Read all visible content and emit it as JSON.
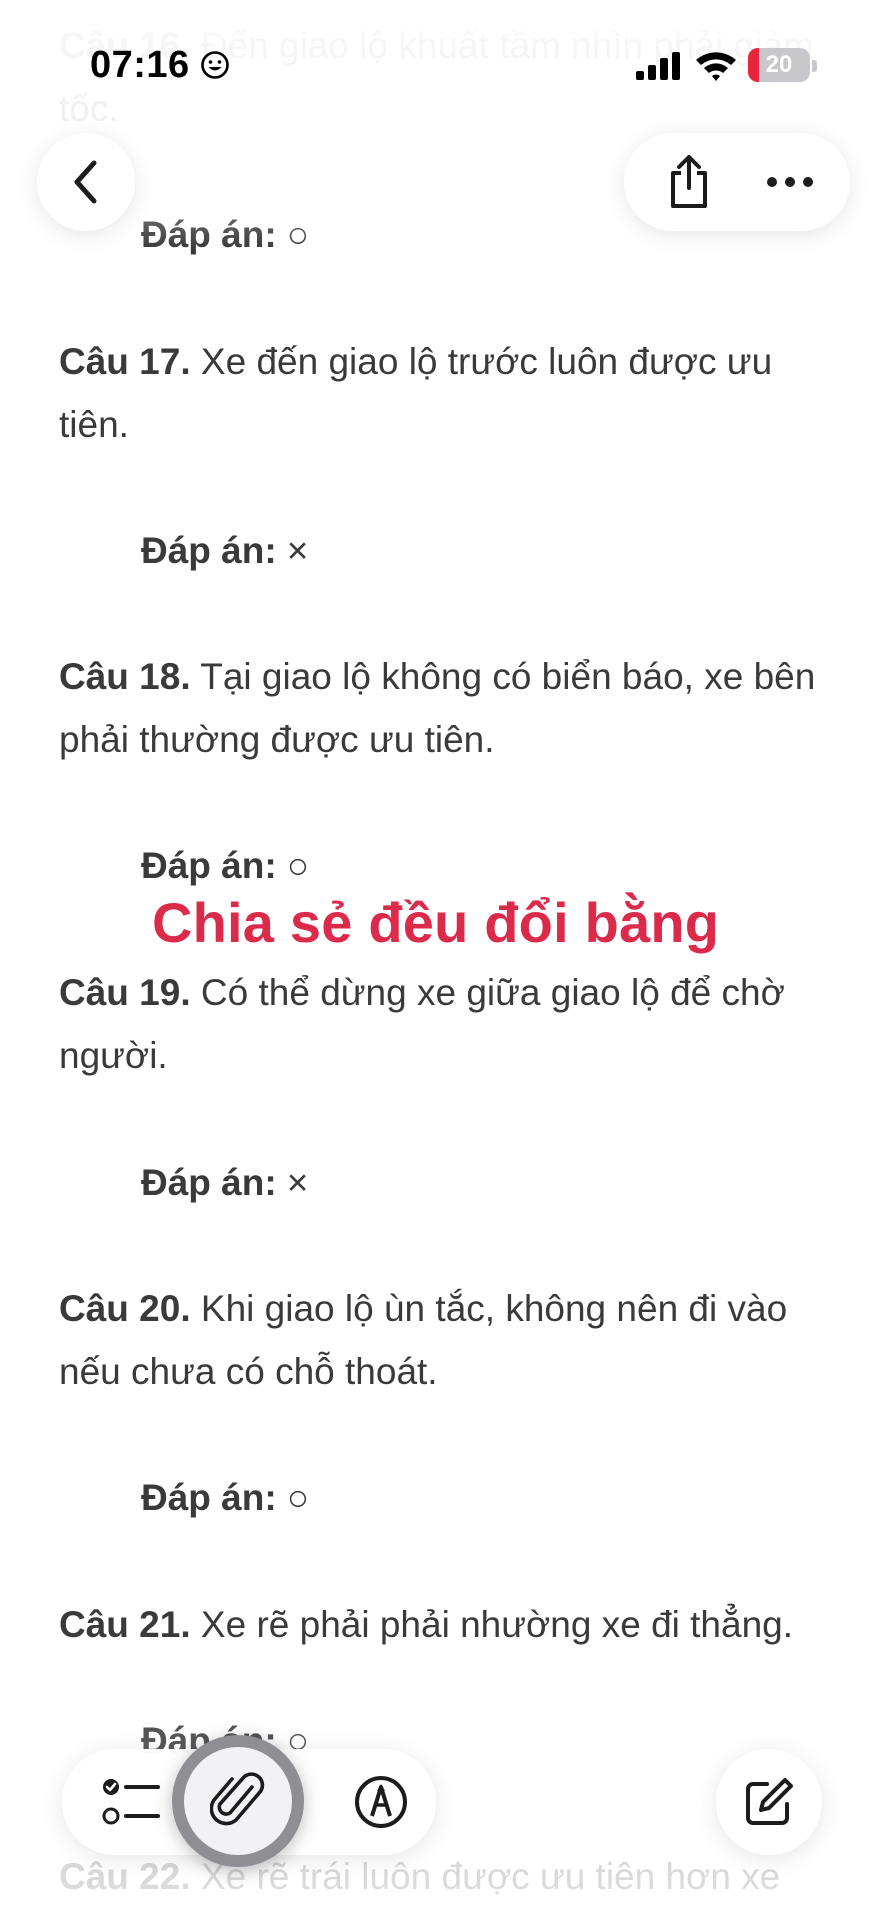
{
  "status_bar": {
    "time": "07:16",
    "battery_level": "20"
  },
  "note": {
    "q16": {
      "number": "Câu 16.",
      "text": "Đến giao lộ khuất tầm nhìn phải giảm tốc.",
      "answer_label": "Đáp án:",
      "answer": "○"
    },
    "q17": {
      "number": "Câu 17.",
      "text": "Xe đến giao lộ trước luôn được ưu tiên.",
      "answer_label": "Đáp án:",
      "answer": "×"
    },
    "q18": {
      "number": "Câu 18.",
      "text": "Tại giao lộ không có biển báo, xe bên phải thường được ưu tiên.",
      "answer_label": "Đáp án:",
      "answer": "○"
    },
    "q19": {
      "number": "Câu 19.",
      "text": "Có thể dừng xe giữa giao lộ để chờ người.",
      "answer_label": "Đáp án:",
      "answer": "×"
    },
    "q20": {
      "number": "Câu 20.",
      "text": "Khi giao lộ ùn tắc, không nên đi vào nếu chưa có chỗ thoát.",
      "answer_label": "Đáp án:",
      "answer": "○"
    },
    "q21": {
      "number": "Câu 21.",
      "text": "Xe rẽ phải phải nhường xe đi thẳng.",
      "answer_label": "Đáp án:",
      "answer": "○"
    },
    "q22": {
      "number": "Câu 22.",
      "text": "Xe rẽ trái luôn được ưu tiên hơn xe"
    }
  },
  "overlay": {
    "caption": "Chia sẻ đều đổi bằng",
    "color": "#dc2b4a"
  },
  "toolbar": {
    "icons": [
      "back-icon",
      "share-icon",
      "more-icon",
      "checklist-icon",
      "attachment-icon",
      "markup-icon",
      "compose-icon"
    ]
  }
}
